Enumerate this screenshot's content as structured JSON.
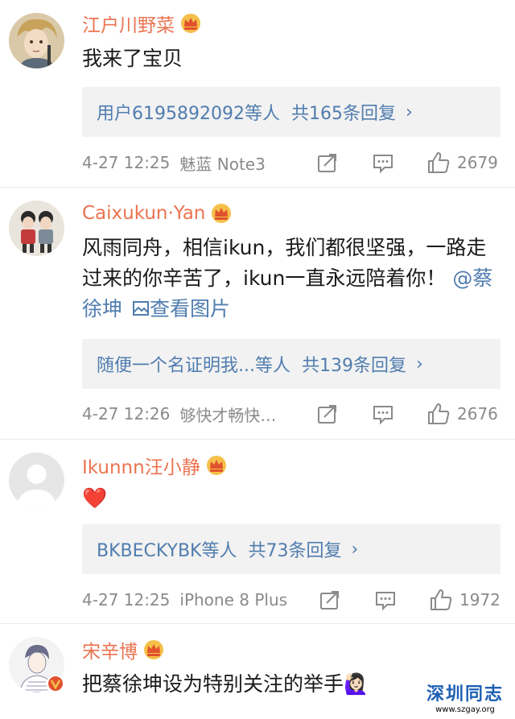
{
  "comments": [
    {
      "username": "江户川野菜",
      "text": "我来了宝贝",
      "reply_prefix": "用户6195892092等人",
      "reply_count": "共165条回复",
      "time": "4-27 12:25",
      "source": "魅蓝 Note3",
      "likes": "2679"
    },
    {
      "username": "Caixukun·Yan",
      "text": "风雨同舟，相信ikun，我们都很坚强，一路走过来的你辛苦了，ikun一直永远陪着你！",
      "mention": "@蔡徐坤",
      "pic_link": "查看图片",
      "reply_prefix": "随便一个名证明我...等人",
      "reply_count": "共139条回复",
      "time": "4-27 12:26",
      "source": "够快才畅快…",
      "likes": "2676"
    },
    {
      "username": "Ikunnn汪小静",
      "text": "❤️",
      "reply_prefix": "BKBECKYBK等人",
      "reply_count": "共73条回复",
      "time": "4-27 12:25",
      "source": "iPhone 8 Plus",
      "likes": "1972"
    },
    {
      "username": "宋辛博",
      "text": "把蔡徐坤设为特别关注的举手🙋🏻‍♀️"
    }
  ],
  "icons": {
    "crown": "crown-icon",
    "forward": "forward-icon",
    "comment": "comment-icon",
    "like": "thumbs-up-icon",
    "image": "image-icon",
    "verified": "verified-badge-icon"
  },
  "colors": {
    "username": "#eb7350",
    "link": "#507daf",
    "meta": "#8a8a8a",
    "reply_bg": "#f2f2f2"
  },
  "watermark": {
    "title": "深圳同志",
    "url": "www.szgay.org"
  }
}
